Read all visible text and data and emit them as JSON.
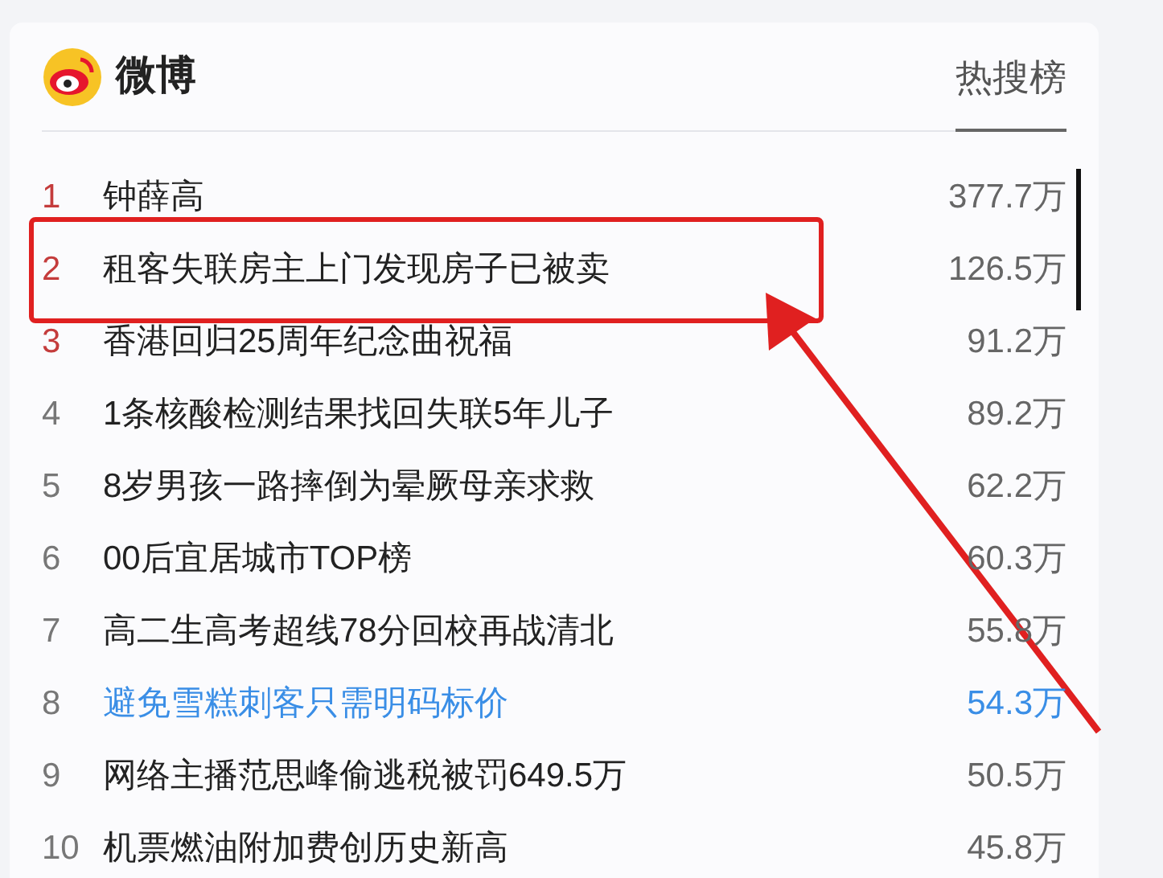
{
  "header": {
    "brand": "微博",
    "tab": {
      "label": "热搜榜",
      "selected": true
    }
  },
  "rows": [
    {
      "rank": "1",
      "title": "钟薛高",
      "heat": "377.7万",
      "top": true,
      "highlighted": false,
      "boxed": false
    },
    {
      "rank": "2",
      "title": "租客失联房主上门发现房子已被卖",
      "heat": "126.5万",
      "top": true,
      "highlighted": false,
      "boxed": true
    },
    {
      "rank": "3",
      "title": "香港回归25周年纪念曲祝福",
      "heat": "91.2万",
      "top": true,
      "highlighted": false,
      "boxed": false
    },
    {
      "rank": "4",
      "title": "1条核酸检测结果找回失联5年儿子",
      "heat": "89.2万",
      "top": false,
      "highlighted": false,
      "boxed": false
    },
    {
      "rank": "5",
      "title": "8岁男孩一路摔倒为晕厥母亲求救",
      "heat": "62.2万",
      "top": false,
      "highlighted": false,
      "boxed": false
    },
    {
      "rank": "6",
      "title": "00后宜居城市TOP榜",
      "heat": "60.3万",
      "top": false,
      "highlighted": false,
      "boxed": false
    },
    {
      "rank": "7",
      "title": "高二生高考超线78分回校再战清北",
      "heat": "55.8万",
      "top": false,
      "highlighted": false,
      "boxed": false
    },
    {
      "rank": "8",
      "title": "避免雪糕刺客只需明码标价",
      "heat": "54.3万",
      "top": false,
      "highlighted": true,
      "boxed": false
    },
    {
      "rank": "9",
      "title": "网络主播范思峰偷逃税被罚649.5万",
      "heat": "50.5万",
      "top": false,
      "highlighted": false,
      "boxed": false
    },
    {
      "rank": "10",
      "title": "机票燃油附加费创历史新高",
      "heat": "45.8万",
      "top": false,
      "highlighted": false,
      "boxed": false
    }
  ]
}
